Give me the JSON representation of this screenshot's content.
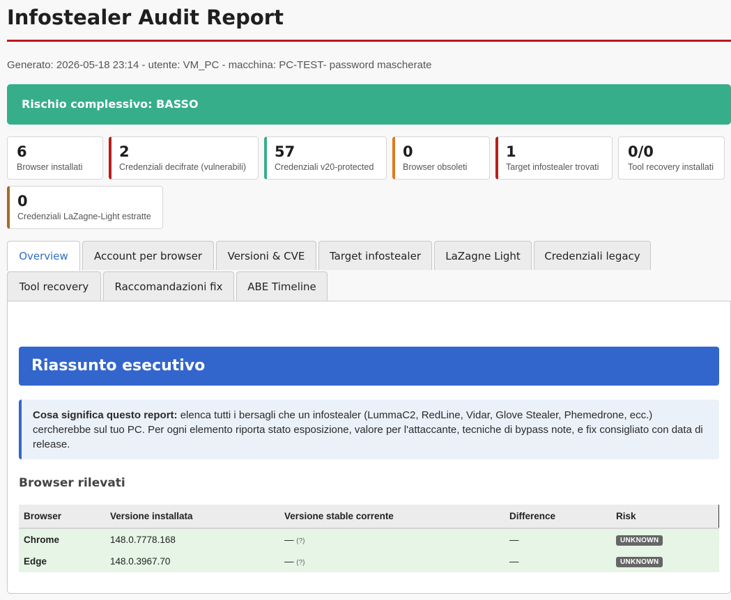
{
  "header": {
    "title": "Infostealer Audit Report",
    "meta": "Generato: 2026-05-18 23:14 - utente: VM_PC - macchina: PC-TEST- password mascherate"
  },
  "risk": {
    "label": "Rischio complessivo: BASSO",
    "color": "#37ae8a"
  },
  "stats": [
    {
      "value": "6",
      "label": "Browser installati"
    },
    {
      "value": "2",
      "label": "Credenziali decifrate (vulnerabili)",
      "accent": "#b81d1d"
    },
    {
      "value": "57",
      "label": "Credenziali v20-protected",
      "accent": "#37ae8a"
    },
    {
      "value": "0",
      "label": "Browser obsoleti",
      "accent": "#de7a1e"
    },
    {
      "value": "1",
      "label": "Target infostealer trovati",
      "accent": "#b81d1d"
    },
    {
      "value": "0/0",
      "label": "Tool recovery installati"
    },
    {
      "value": "0",
      "label": "Credenziali LaZagne-Light estratte",
      "accent": "#a66a2a"
    }
  ],
  "tabs": [
    {
      "label": "Overview",
      "active": true
    },
    {
      "label": "Account per browser"
    },
    {
      "label": "Versioni & CVE"
    },
    {
      "label": "Target infostealer"
    },
    {
      "label": "LaZagne Light"
    },
    {
      "label": "Credenziali legacy"
    },
    {
      "label": "Tool recovery"
    },
    {
      "label": "Raccomandazioni fix"
    },
    {
      "label": "ABE Timeline"
    }
  ],
  "overview": {
    "section_title": "Riassunto esecutivo",
    "note_bold": "Cosa significa questo report:",
    "note_text": " elenca tutti i bersagli che un infostealer (LummaC2, RedLine, Vidar, Glove Stealer, Phemedrone, ecc.) cercherebbe sul tuo PC. Per ogni elemento riporta stato esposizione, valore per l'attaccante, tecniche di bypass note, e fix consigliato con data di release.",
    "browsers_heading": "Browser rilevati",
    "table": {
      "headers": [
        "Browser",
        "Versione installata",
        "Versione stable corrente",
        "Difference",
        "Risk"
      ],
      "rows": [
        {
          "browser": "Chrome",
          "installed": "148.0.7778.168",
          "stable": "—",
          "stable_help": "(?)",
          "difference": "—",
          "risk": "UNKNOWN"
        },
        {
          "browser": "Edge",
          "installed": "148.0.3967.70",
          "stable": "—",
          "stable_help": "(?)",
          "difference": "—",
          "risk": "UNKNOWN"
        }
      ]
    }
  },
  "colors": {
    "accent_red": "#c0151b",
    "section_blue": "#3366cc",
    "badge_gray": "#666666"
  }
}
